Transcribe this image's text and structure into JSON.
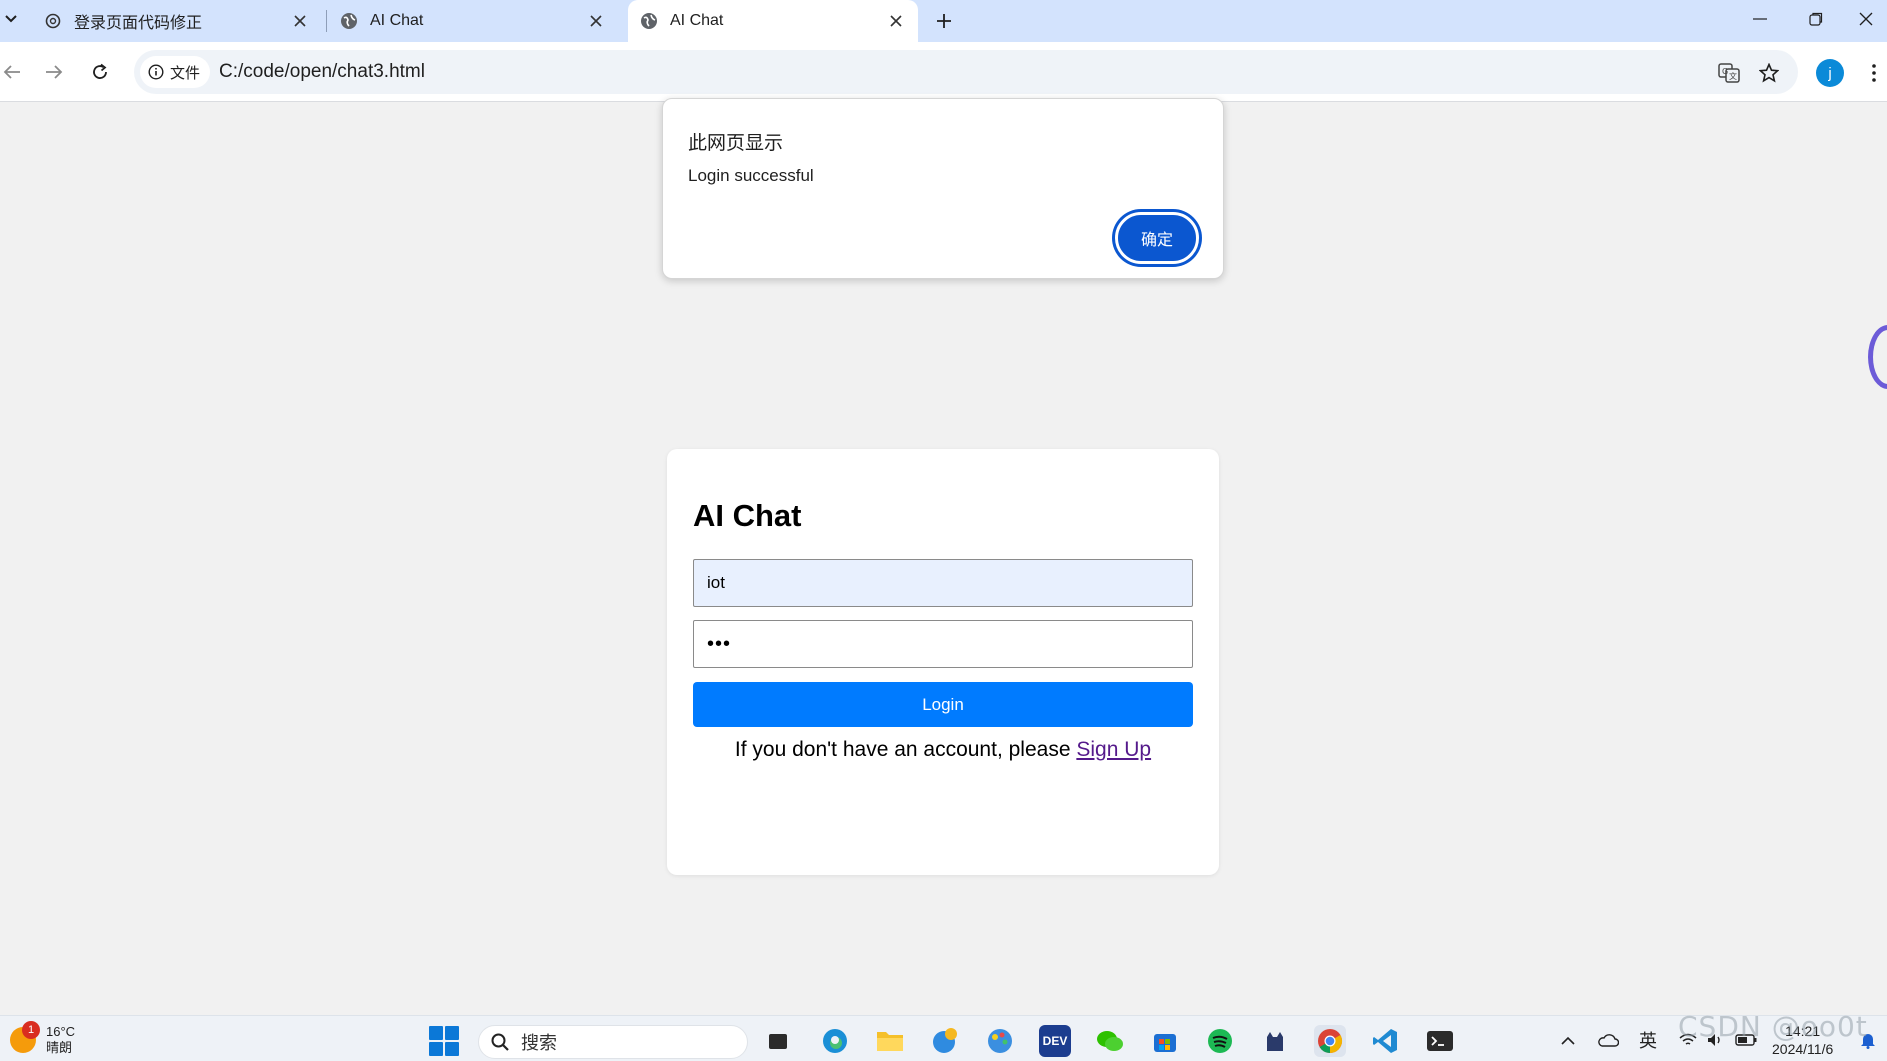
{
  "browser": {
    "tabs": [
      {
        "title": "登录页面代码修正",
        "icon": "chatgpt-icon",
        "active": false
      },
      {
        "title": "AI Chat",
        "icon": "globe-icon",
        "active": false
      },
      {
        "title": "AI Chat",
        "icon": "globe-icon",
        "active": true
      }
    ],
    "site_chip_label": "文件",
    "url": "C:/code/open/chat3.html",
    "profile_initial": "j"
  },
  "dialog": {
    "title": "此网页显示",
    "message": "Login successful",
    "ok_label": "确定"
  },
  "login": {
    "title": "AI Chat",
    "username_value": "iot",
    "password_value": "•••",
    "button_label": "Login",
    "signup_prompt": "If you don't have an account, please",
    "signup_link": "Sign Up"
  },
  "taskbar": {
    "weather_temp": "16°C",
    "weather_desc": "晴朗",
    "weather_badge": "1",
    "search_placeholder": "搜索",
    "apps": [
      {
        "name": "dark-app",
        "label": ""
      },
      {
        "name": "edge",
        "label": ""
      },
      {
        "name": "file-explorer",
        "label": ""
      },
      {
        "name": "edge-beta",
        "label": ""
      },
      {
        "name": "paint",
        "label": ""
      },
      {
        "name": "dev-cpp",
        "label": "DEV"
      },
      {
        "name": "wechat",
        "label": ""
      },
      {
        "name": "store",
        "label": ""
      },
      {
        "name": "spotify",
        "label": ""
      },
      {
        "name": "cat-app",
        "label": ""
      },
      {
        "name": "chrome",
        "label": ""
      },
      {
        "name": "vscode",
        "label": ""
      },
      {
        "name": "terminal",
        "label": ""
      }
    ],
    "ime": "英",
    "time": "14:21",
    "date": "2024/11/6"
  },
  "watermark": "CSDN @oo0t",
  "colors": {
    "primary_button": "#007bff",
    "dialog_button": "#0b57d0",
    "link_visited": "#551a8b"
  }
}
